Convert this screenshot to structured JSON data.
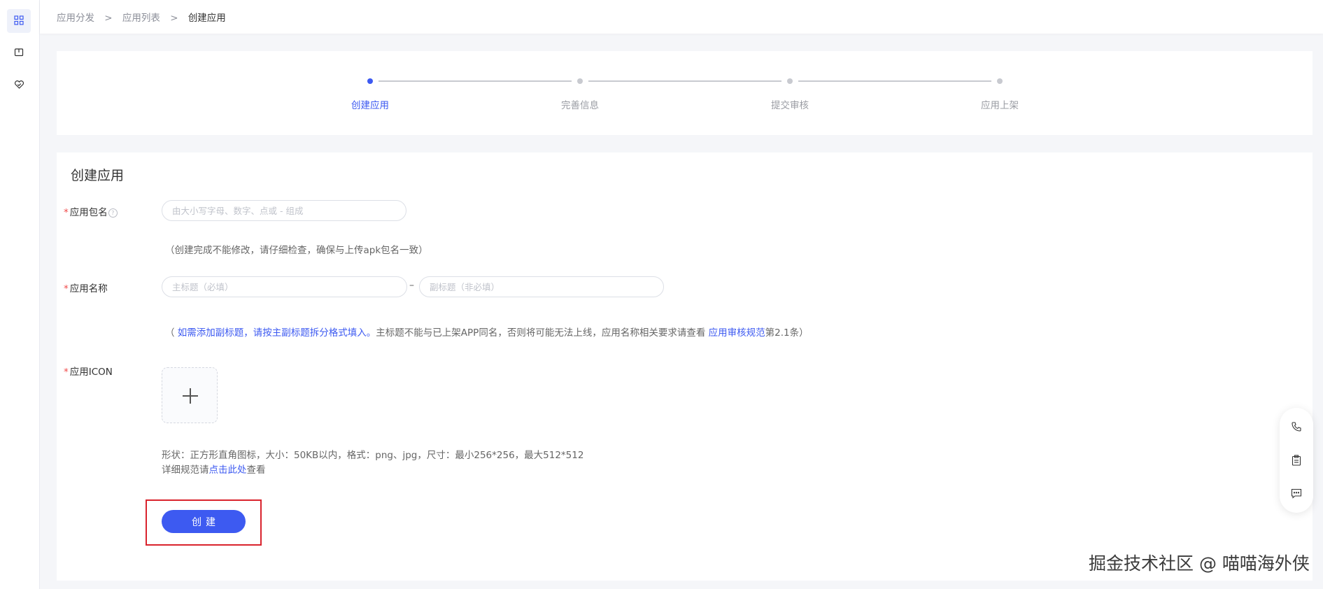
{
  "sidebar": {
    "items": [
      {
        "icon": "grid-icon",
        "active": true
      },
      {
        "icon": "book-icon",
        "active": false
      },
      {
        "icon": "heart-badge-icon",
        "active": false
      }
    ]
  },
  "breadcrumb": {
    "items": [
      "应用分发",
      "应用列表"
    ],
    "separator": ">",
    "current": "创建应用"
  },
  "steps": [
    {
      "label": "创建应用",
      "active": true
    },
    {
      "label": "完善信息",
      "active": false
    },
    {
      "label": "提交审核",
      "active": false
    },
    {
      "label": "应用上架",
      "active": false
    }
  ],
  "form": {
    "title": "创建应用",
    "required_mark": "*",
    "package": {
      "label": "应用包名",
      "help": "?",
      "placeholder": "由大小写字母、数字、点或 - 组成",
      "hint": "（创建完成不能修改，请仔细检查，确保与上传apk包名一致）"
    },
    "name": {
      "label": "应用名称",
      "main_placeholder": "主标题（必填）",
      "separator": "–",
      "sub_placeholder": "副标题（非必填）",
      "hint_open": "（ ",
      "hint_link1": "如需添加副标题，请按主副标题拆分格式填入。",
      "hint_mid": "主标题不能与已上架APP同名，否则将可能无法上线，应用名称相关要求请查看 ",
      "hint_link2": "应用审核规范",
      "hint_end": "第2.1条）"
    },
    "icon": {
      "label": "应用ICON",
      "spec_line": "形状：正方形直角图标，大小：50KB以内，格式：png、jpg，尺寸：最小256*256，最大512*512",
      "detail_prefix": "详细规范请",
      "detail_link": "点击此处",
      "detail_suffix": "查看"
    },
    "submit_label": "创建"
  },
  "float_panel": {
    "items": [
      "phone-icon",
      "clipboard-icon",
      "message-icon"
    ]
  },
  "watermark": "掘金技术社区 @ 喵喵海外侠",
  "colors": {
    "accent": "#3d5af1",
    "required": "#f04b4b",
    "highlight": "#d9232d"
  }
}
